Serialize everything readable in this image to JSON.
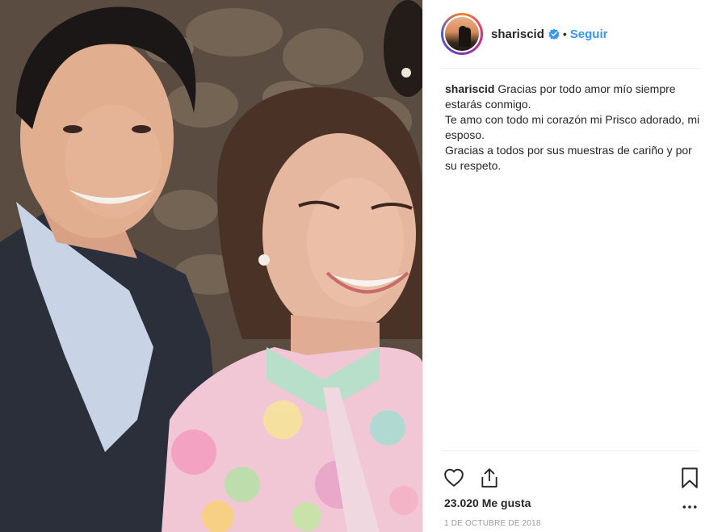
{
  "header": {
    "username": "shariscid",
    "separator": "•",
    "follow_label": "Seguir"
  },
  "caption": {
    "username": "shariscid",
    "lines": [
      "Gracias por todo amor mío siempre estarás conmigo.",
      "Te amo con todo mi corazón mi Prisco adorado, mi esposo.",
      "Gracias a todos por sus muestras de cariño y por su respeto."
    ]
  },
  "engagement": {
    "likes": "23.020 Me gusta",
    "date": "1 DE OCTUBRE DE 2018"
  },
  "icons": {
    "verified": "verified-badge-icon",
    "like": "heart-icon",
    "share": "share-icon",
    "save": "bookmark-icon",
    "more": "more-options-icon"
  },
  "colors": {
    "follow": "#3897f0",
    "verified": "#3897f0",
    "text": "#262626",
    "muted": "#999999",
    "divider": "#efefef"
  }
}
